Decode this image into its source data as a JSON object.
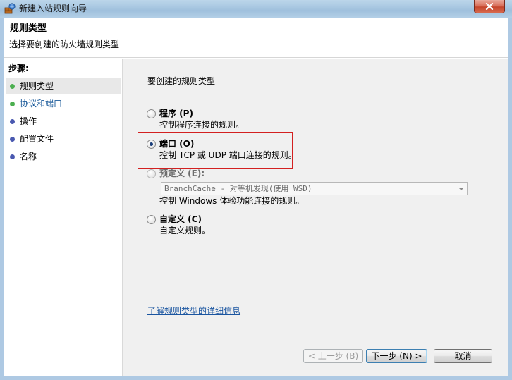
{
  "window": {
    "title": "新建入站规则向导",
    "icons": {
      "app": "firewall-wizard-icon",
      "close": "close-icon"
    }
  },
  "header": {
    "title": "规则类型",
    "subtitle": "选择要创建的防火墙规则类型"
  },
  "steps": {
    "label": "步骤:",
    "items": [
      {
        "label": "规则类型",
        "state": "current",
        "dot_color": "#4caf50"
      },
      {
        "label": "协议和端口",
        "state": "link",
        "dot_color": "#4caf50"
      },
      {
        "label": "操作",
        "state": "pending",
        "dot_color": "#4a59b0"
      },
      {
        "label": "配置文件",
        "state": "pending",
        "dot_color": "#4a59b0"
      },
      {
        "label": "名称",
        "state": "pending",
        "dot_color": "#4a59b0"
      }
    ]
  },
  "main": {
    "prompt": "要创建的规则类型",
    "options": [
      {
        "label": "程序 (P)",
        "description": "控制程序连接的规则。",
        "checked": false,
        "enabled": true
      },
      {
        "label": "端口 (O)",
        "description": "控制 TCP 或 UDP 端口连接的规则。",
        "checked": true,
        "enabled": true
      },
      {
        "label": "预定义 (E):",
        "description": "控制 Windows 体验功能连接的规则。",
        "checked": false,
        "enabled": false,
        "select_value": "BranchCache - 对等机发现(使用 WSD)"
      },
      {
        "label": "自定义 (C)",
        "description": "自定义规则。",
        "checked": false,
        "enabled": true
      }
    ],
    "learn_more_link": "了解规则类型的详细信息"
  },
  "buttons": {
    "back": "< 上一步 (B)",
    "next": "下一步 (N) >",
    "cancel": "取消"
  },
  "colors": {
    "highlight_border": "#d32020",
    "link": "#1a55a0",
    "titlebar": "#aec9e3"
  }
}
